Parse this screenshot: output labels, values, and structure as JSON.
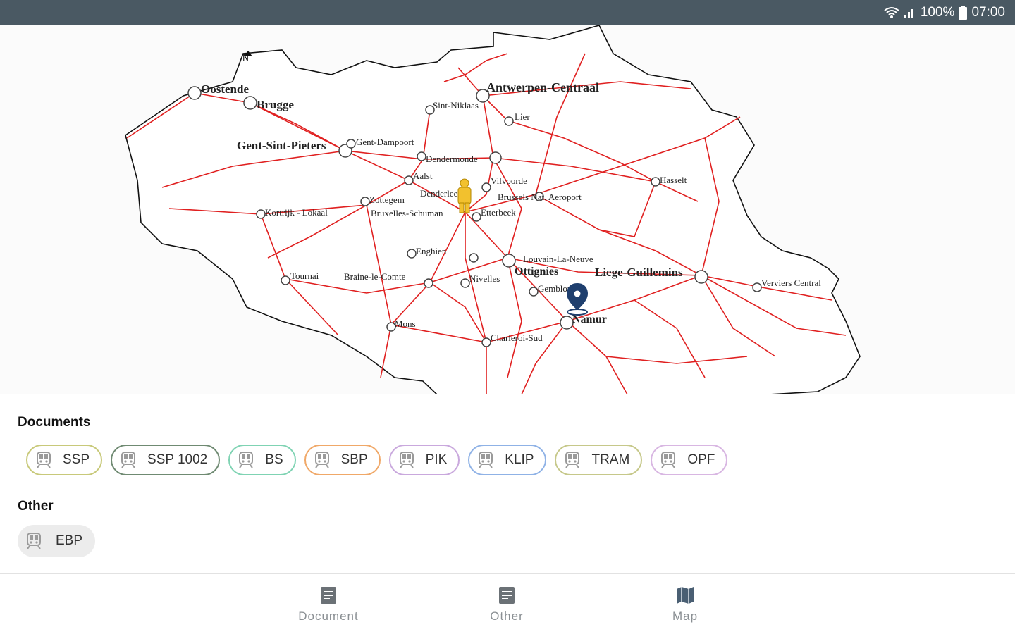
{
  "status": {
    "battery": "100%",
    "time": "07:00"
  },
  "map": {
    "cities": [
      {
        "name": "Oostende"
      },
      {
        "name": "Brugge"
      },
      {
        "name": "Antwerpen-Centraal"
      },
      {
        "name": "Sint-Niklaas"
      },
      {
        "name": "Lier"
      },
      {
        "name": "Gent-Sint-Pieters"
      },
      {
        "name": "Gent-Dampoort"
      },
      {
        "name": "Dendermonde"
      },
      {
        "name": "Aalst"
      },
      {
        "name": "Vilvoorde"
      },
      {
        "name": "Denderleeuw"
      },
      {
        "name": "Brussels Nat. Aeroport"
      },
      {
        "name": "Zottegem"
      },
      {
        "name": "Bruxelles-Schuman"
      },
      {
        "name": "Etterbeek"
      },
      {
        "name": "Hasselt"
      },
      {
        "name": "Kortrijk - Lokaal"
      },
      {
        "name": "Enghien"
      },
      {
        "name": "Louvain-La-Neuve"
      },
      {
        "name": "Ottignies"
      },
      {
        "name": "Liege-Guillemins"
      },
      {
        "name": "Tournai"
      },
      {
        "name": "Braine-le-Comte"
      },
      {
        "name": "Nivelles"
      },
      {
        "name": "Gembloux"
      },
      {
        "name": "Verviers Central"
      },
      {
        "name": "Namur"
      },
      {
        "name": "Mons"
      },
      {
        "name": "Charleroi-Sud"
      }
    ]
  },
  "documents": {
    "title": "Documents",
    "chips": [
      {
        "label": "SSP",
        "color": "#c8c97a"
      },
      {
        "label": "SSP 1002",
        "color": "#6f8a72"
      },
      {
        "label": "BS",
        "color": "#7fd3b3"
      },
      {
        "label": "SBP",
        "color": "#f0a868"
      },
      {
        "label": "PIK",
        "color": "#c9a8dd"
      },
      {
        "label": "KLIP",
        "color": "#8fb2e6"
      },
      {
        "label": "TRAM",
        "color": "#c6c88a"
      },
      {
        "label": "OPF",
        "color": "#d8b6e2"
      }
    ]
  },
  "other": {
    "title": "Other",
    "chips": [
      {
        "label": "EBP"
      }
    ]
  },
  "nav": [
    {
      "label": "Document",
      "icon": "document-icon"
    },
    {
      "label": "Other",
      "icon": "document-icon"
    },
    {
      "label": "Map",
      "icon": "map-icon"
    }
  ]
}
